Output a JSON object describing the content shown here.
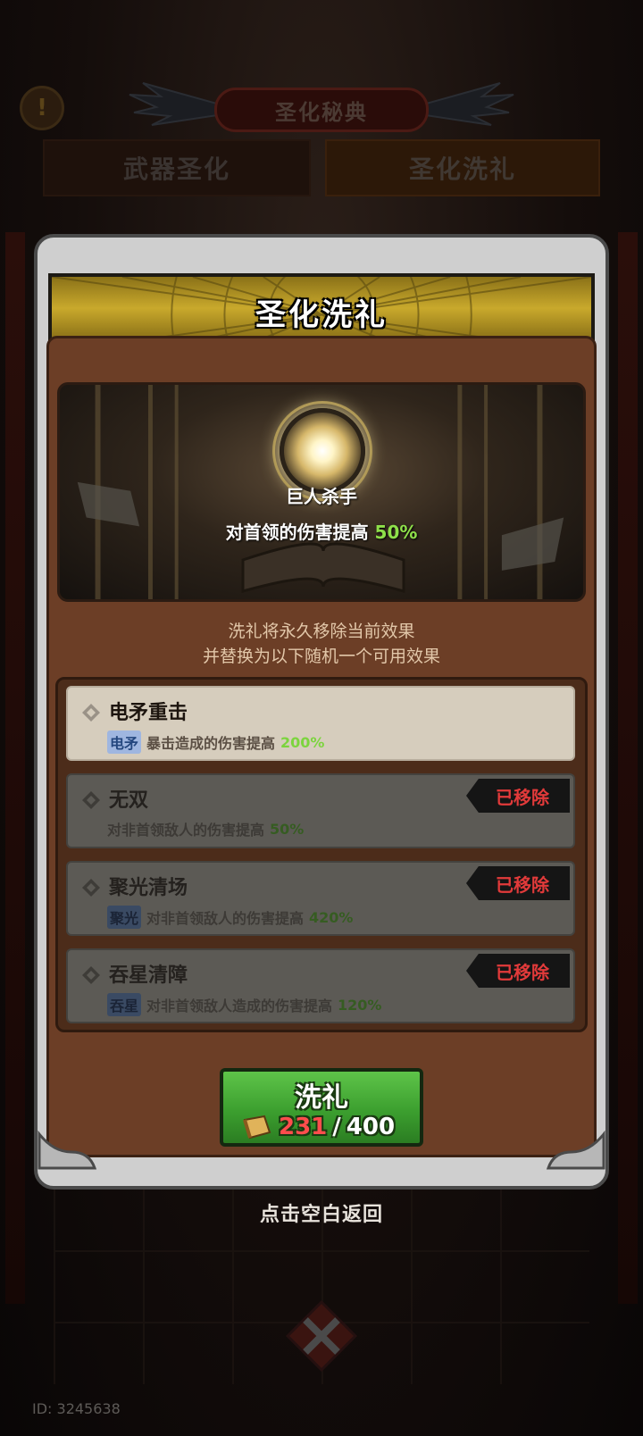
{
  "header": {
    "title": "圣化秘典",
    "info_icon": "exclamation-icon",
    "tabs": [
      {
        "label": "武器圣化",
        "active": false
      },
      {
        "label": "圣化洗礼",
        "active": true
      }
    ]
  },
  "panel": {
    "banner_title": "圣化洗礼",
    "current_effect": {
      "name": "巨人杀手",
      "desc": "对首领的伤害提高",
      "value": "50%"
    },
    "info_line1": "洗礼将永久移除当前效果",
    "info_line2": "并替换为以下随机一个可用效果",
    "effects": [
      {
        "name": "电矛重击",
        "tag": "电矛",
        "desc": "暴击造成的伤害提高",
        "value": "200%",
        "removed": false
      },
      {
        "name": "无双",
        "tag": "",
        "desc": "对非首领敌人的伤害提高",
        "value": "50%",
        "removed": true,
        "status": "已移除"
      },
      {
        "name": "聚光清场",
        "tag": "聚光",
        "desc": "对非首领敌人的伤害提高",
        "value": "420%",
        "removed": true,
        "status": "已移除"
      },
      {
        "name": "吞星清障",
        "tag": "吞星",
        "desc": "对非首领敌人造成的伤害提高",
        "value": "120%",
        "removed": true,
        "status": "已移除"
      }
    ],
    "baptize_button": {
      "label": "洗礼",
      "current": "231",
      "separator": "/",
      "required": "400",
      "icon": "scroll-icon"
    }
  },
  "hint": "点击空白返回",
  "footer_id": "ID: 3245638",
  "colors": {
    "accent_green": "#8ee04a",
    "removed_red": "#e23a3a",
    "button_green": "#3c9f2f"
  }
}
